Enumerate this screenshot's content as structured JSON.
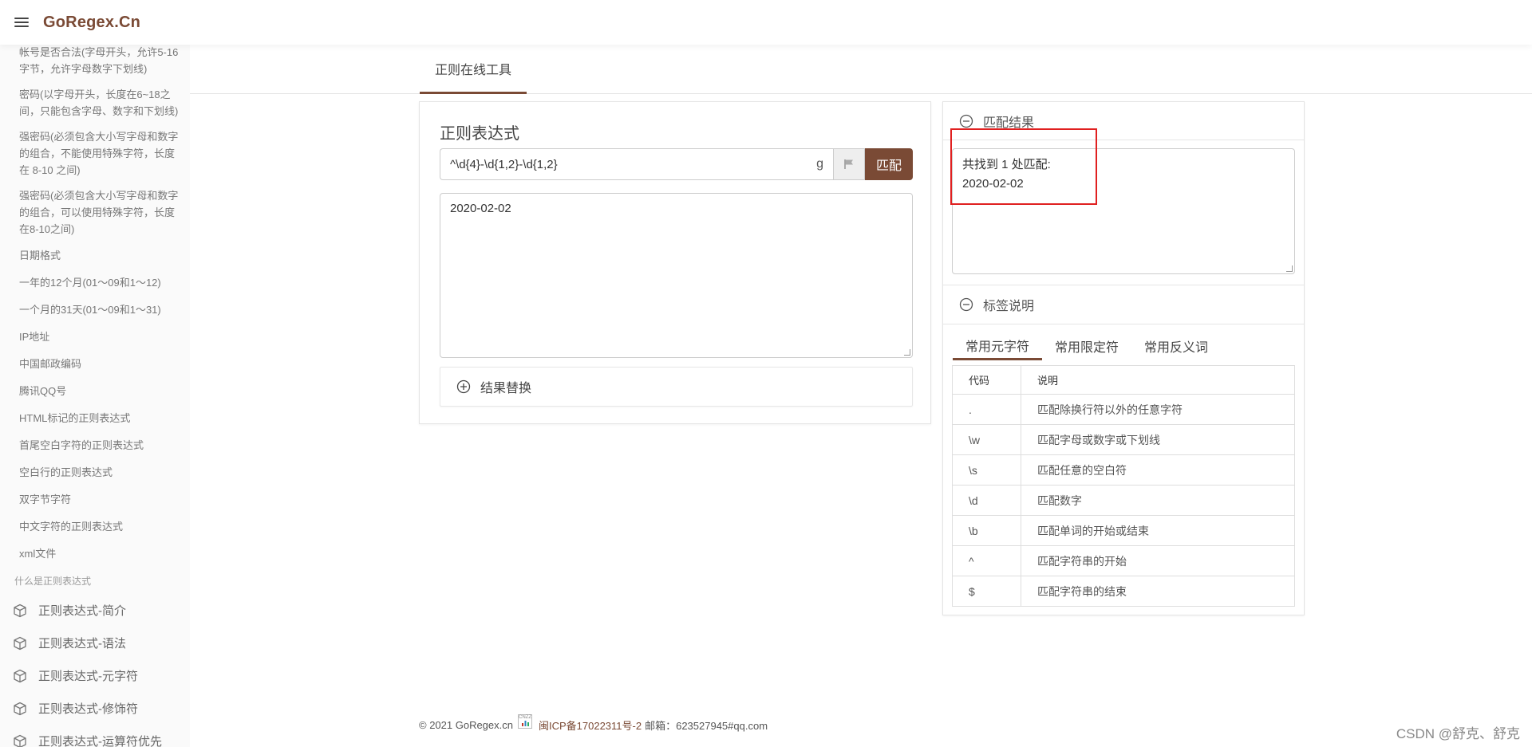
{
  "header": {
    "brand": "GoRegex.Cn"
  },
  "sidebar": {
    "items": [
      "帐号是否合法(字母开头，允许5-16字节，允许字母数字下划线)",
      "密码(以字母开头，长度在6~18之间，只能包含字母、数字和下划线)",
      "强密码(必须包含大小写字母和数字的组合，不能使用特殊字符，长度在 8-10 之间)",
      "强密码(必须包含大小写字母和数字的组合，可以使用特殊字符，长度在8-10之间)",
      "日期格式",
      "一年的12个月(01～09和1～12)",
      "一个月的31天(01～09和1～31)",
      "IP地址",
      "中国邮政编码",
      "腾讯QQ号",
      "HTML标记的正则表达式",
      "首尾空白字符的正则表达式",
      "空白行的正则表达式",
      "双字节字符",
      "中文字符的正则表达式",
      "xml文件"
    ],
    "section_label": "什么是正则表达式",
    "nav": [
      "正则表达式-简介",
      "正则表达式-语法",
      "正则表达式-元字符",
      "正则表达式-修饰符",
      "正则表达式-运算符优先"
    ]
  },
  "main": {
    "tab_label": "正则在线工具"
  },
  "regex_panel": {
    "title": "正则表达式",
    "pattern": "^\\d{4}-\\d{1,2}-\\d{1,2}",
    "flags": "g",
    "match_button": "匹配",
    "test_text": "2020-02-02",
    "replace_label": "结果替换"
  },
  "result_panel": {
    "header": "匹配结果",
    "summary": "共找到 1 处匹配:",
    "matches": [
      "2020-02-02"
    ]
  },
  "reference_panel": {
    "header": "标签说明",
    "tabs": [
      "常用元字符",
      "常用限定符",
      "常用反义词"
    ],
    "columns": [
      "代码",
      "说明"
    ],
    "rows": [
      [
        ".",
        "匹配除换行符以外的任意字符"
      ],
      [
        "\\w",
        "匹配字母或数字或下划线"
      ],
      [
        "\\s",
        "匹配任意的空白符"
      ],
      [
        "\\d",
        "匹配数字"
      ],
      [
        "\\b",
        "匹配单词的开始或结束"
      ],
      [
        "^",
        "匹配字符串的开始"
      ],
      [
        "$",
        "匹配字符串的结束"
      ]
    ]
  },
  "footer": {
    "copyright": "© 2021 GoRegex.cn",
    "badge": "CNZZ",
    "icp": "闽ICP备17022311号-2",
    "email": "邮箱：623527945#qq.com"
  },
  "watermark": "CSDN @舒克、舒克",
  "colors": {
    "accent": "#7a4a35",
    "highlight": "#e02020"
  }
}
